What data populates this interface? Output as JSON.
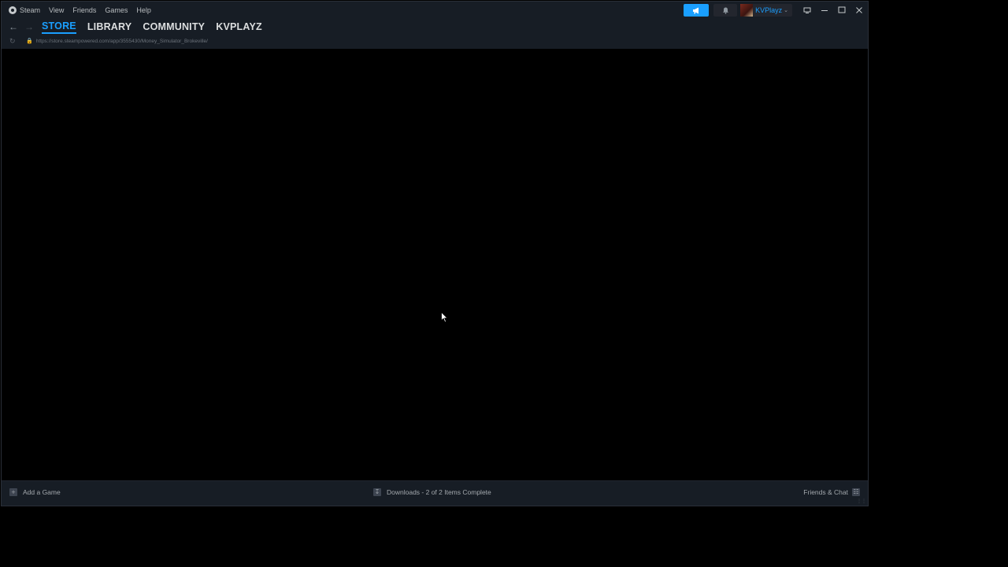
{
  "menubar": {
    "items": [
      "Steam",
      "View",
      "Friends",
      "Games",
      "Help"
    ]
  },
  "header": {
    "username": "KVPlayz"
  },
  "nav": {
    "tabs": [
      "STORE",
      "LIBRARY",
      "COMMUNITY",
      "KVPLAYZ"
    ],
    "active_tab": "STORE"
  },
  "urlbar": {
    "url": "https://store.steampowered.com/app/3555430/Money_Simulator_Brokeville/"
  },
  "bottombar": {
    "add_game": "Add a Game",
    "downloads": "Downloads - 2 of 2 Items Complete",
    "friends": "Friends & Chat"
  },
  "icons": {
    "announce": "megaphone-icon",
    "bell": "bell-icon",
    "back": "back-arrow-icon",
    "forward": "forward-arrow-icon",
    "reload": "reload-icon",
    "lock": "lock-icon"
  },
  "colors": {
    "accent": "#1a9fff",
    "window_bg": "#171d25",
    "content_bg": "#000000"
  }
}
